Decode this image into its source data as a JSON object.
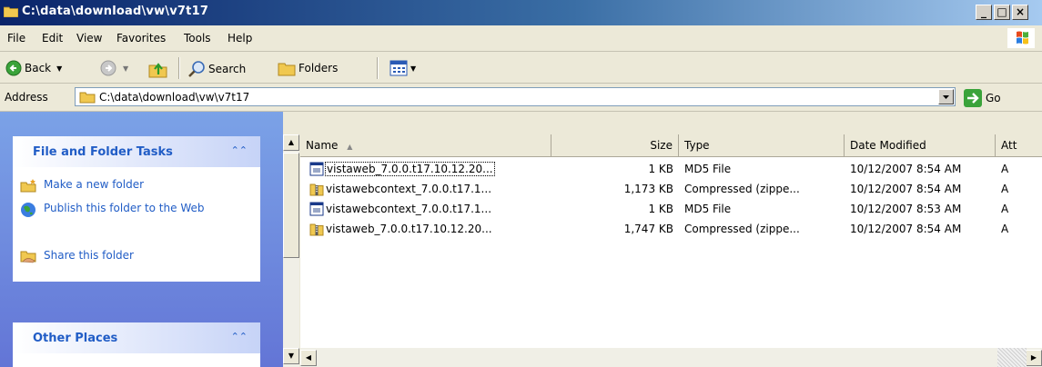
{
  "window": {
    "title": "C:\\data\\download\\vw\\v7t17",
    "controls": {
      "minimize": "_",
      "maximize": "□",
      "close": "×"
    }
  },
  "menu": [
    "File",
    "Edit",
    "View",
    "Favorites",
    "Tools",
    "Help"
  ],
  "toolbar": {
    "back": "Back",
    "search": "Search",
    "folders": "Folders"
  },
  "address": {
    "label": "Address",
    "value": "C:\\data\\download\\vw\\v7t17",
    "go": "Go"
  },
  "left_pane": {
    "file_tasks": {
      "title": "File and Folder Tasks",
      "items": [
        "Make a new folder",
        "Publish this folder to the Web",
        "Share this folder"
      ]
    },
    "other_places": {
      "title": "Other Places"
    }
  },
  "columns": [
    "Name",
    "Size",
    "Type",
    "Date Modified",
    "Att"
  ],
  "files": [
    {
      "name": "vistaweb_7.0.0.t17.10.12.20...",
      "size": "1 KB",
      "type": "MD5 File",
      "date": "10/12/2007 8:54 AM",
      "attr": "A",
      "icon": "md5-file-icon"
    },
    {
      "name": "vistawebcontext_7.0.0.t17.1...",
      "size": "1,173 KB",
      "type": "Compressed (zippe...",
      "date": "10/12/2007 8:54 AM",
      "attr": "A",
      "icon": "zip-file-icon"
    },
    {
      "name": "vistawebcontext_7.0.0.t17.1...",
      "size": "1 KB",
      "type": "MD5 File",
      "date": "10/12/2007 8:53 AM",
      "attr": "A",
      "icon": "md5-file-icon"
    },
    {
      "name": "vistaweb_7.0.0.t17.10.12.20...",
      "size": "1,747 KB",
      "type": "Compressed (zippe...",
      "date": "10/12/2007 8:54 AM",
      "attr": "A",
      "icon": "zip-file-icon"
    }
  ]
}
